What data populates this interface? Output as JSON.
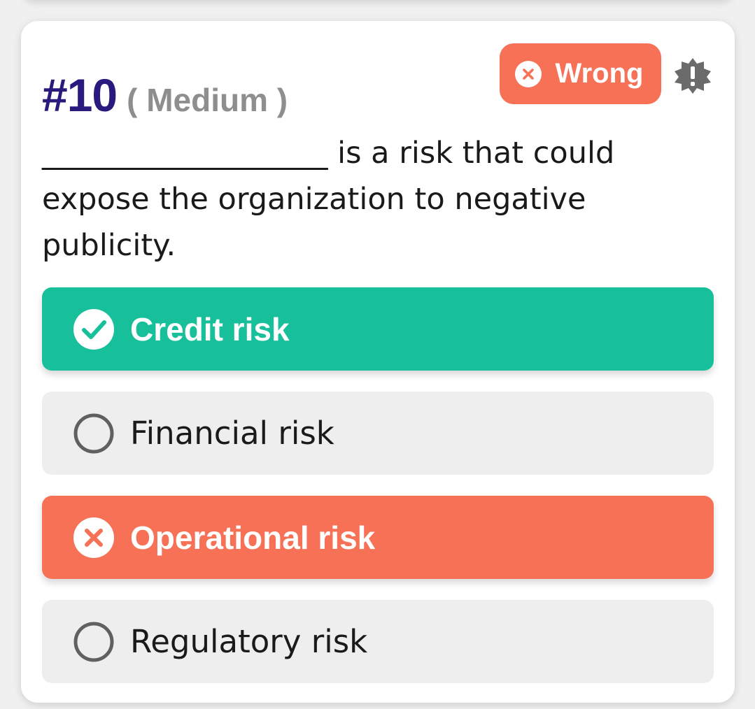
{
  "question": {
    "number": "#10",
    "difficulty": "( Medium )",
    "text": "___________________ is a risk that could expose the organization to negative publicity."
  },
  "status": {
    "label": "Wrong",
    "icon": "x-circle-icon",
    "color": "#f77157"
  },
  "report": {
    "icon": "alert-badge-icon"
  },
  "options": [
    {
      "label": "Credit risk",
      "state": "correct",
      "icon": "check-circle-icon",
      "color": "#17bf9a"
    },
    {
      "label": "Financial risk",
      "state": "unselected",
      "icon": "radio-empty-icon"
    },
    {
      "label": "Operational risk",
      "state": "wrong",
      "icon": "x-circle-icon",
      "color": "#f77157"
    },
    {
      "label": "Regulatory risk",
      "state": "unselected",
      "icon": "radio-empty-icon"
    }
  ],
  "colors": {
    "title": "#2b1a7d",
    "difficulty": "#8e8e8e",
    "neutral_option": "#eeeeee"
  }
}
